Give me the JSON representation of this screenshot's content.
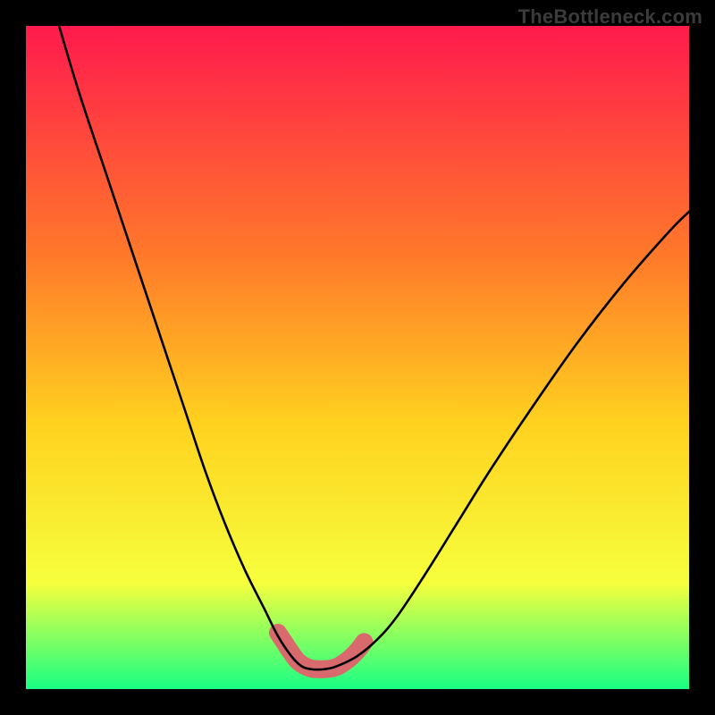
{
  "watermark": "TheBottleneck.com",
  "colors": {
    "frame": "#000000",
    "curve": "#000000",
    "marker": "#d86a6d",
    "grad_top": "#ff1a4d",
    "grad_mid1": "#ff7a2a",
    "grad_mid2": "#ffd21f",
    "grad_mid3": "#f6ff3d",
    "grad_bottom": "#19ff84"
  },
  "plot": {
    "left": 29,
    "top": 29,
    "size": 742
  },
  "chart_data": {
    "type": "line",
    "title": "",
    "xlabel": "",
    "ylabel": "",
    "xlim": [
      0,
      100
    ],
    "ylim": [
      0,
      100
    ],
    "grid": false,
    "series": [
      {
        "name": "curve",
        "x": [
          5,
          8,
          12,
          16,
          20,
          24,
          27,
          30,
          33,
          36,
          38,
          40,
          41.5,
          43,
          45,
          47,
          50,
          53,
          56,
          60,
          65,
          70,
          76,
          83,
          90,
          97,
          100
        ],
        "values": [
          100,
          90,
          78,
          66,
          54,
          42,
          33,
          25,
          18,
          12,
          8,
          5,
          3.5,
          3,
          3,
          3.5,
          5,
          7.5,
          11,
          17,
          25,
          33,
          42,
          52,
          61,
          69,
          72
        ]
      },
      {
        "name": "marker",
        "x": [
          38,
          39,
          40,
          41,
          42,
          43,
          44,
          45,
          46,
          47,
          48,
          49,
          50,
          51
        ],
        "values": [
          8.5,
          7,
          5.5,
          4.2,
          3.5,
          3.1,
          3,
          3,
          3.1,
          3.4,
          4,
          4.8,
          5.8,
          7.1
        ]
      }
    ],
    "annotations": []
  }
}
